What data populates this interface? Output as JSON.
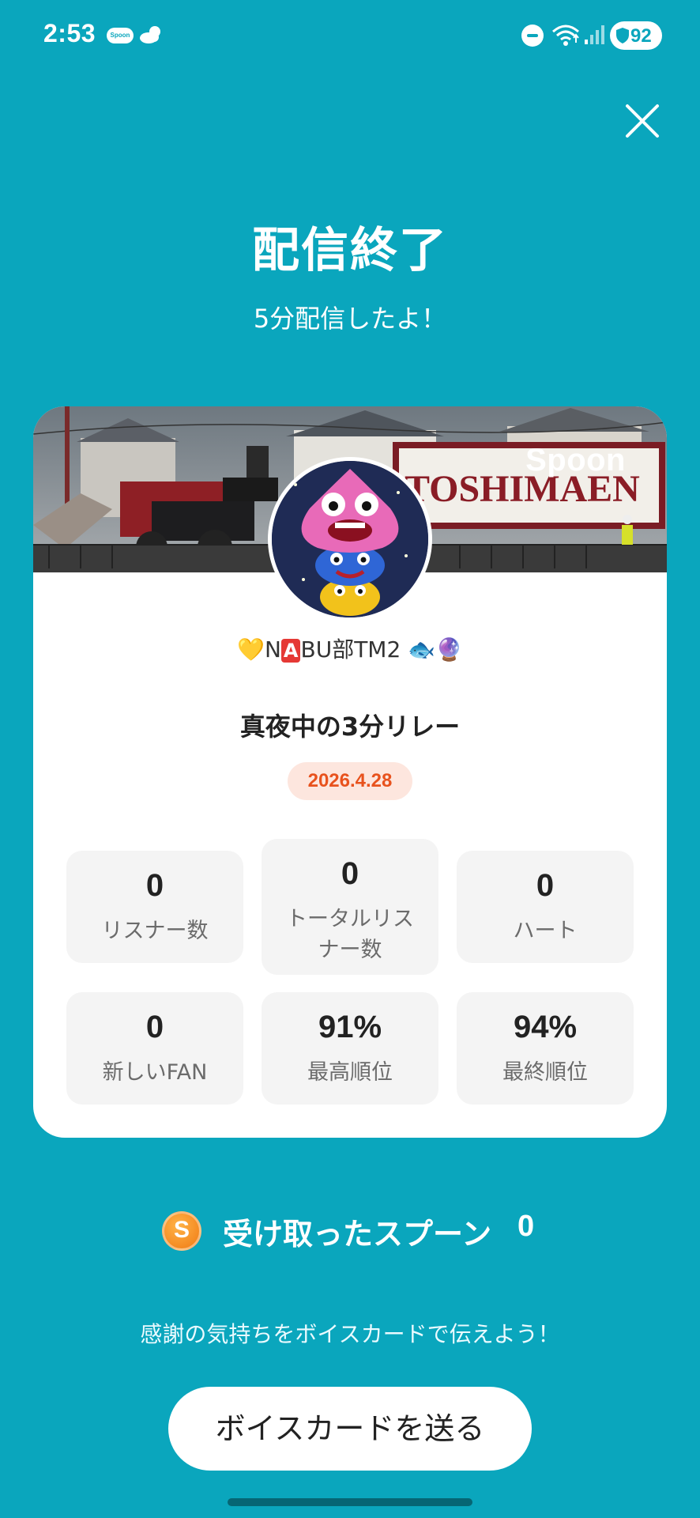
{
  "status_bar": {
    "time": "2:53",
    "app_badge": "Spoon",
    "battery": "92"
  },
  "header": {
    "title": "配信終了",
    "subtitle": "5分配信したよ！"
  },
  "card": {
    "banner_brand": "Spoon",
    "banner_sign": "TOSHIMAEN",
    "username_parts": {
      "heart": "💛",
      "n": "N",
      "a_badge": "A",
      "rest": "BU部TM2 ",
      "fish": "🐟",
      "ball": "🔮"
    },
    "show_title": "真夜中の3分リレー",
    "date": "2026.4.28",
    "stats": [
      {
        "value": "0",
        "label": "リスナー数"
      },
      {
        "value": "0",
        "label_line1": "トータルリス",
        "label_line2": "ナー数"
      },
      {
        "value": "0",
        "label": "ハート"
      },
      {
        "value": "0",
        "label": "新しいFAN"
      },
      {
        "value": "91%",
        "label": "最高順位"
      },
      {
        "value": "94%",
        "label": "最終順位"
      }
    ]
  },
  "spoons": {
    "coin_letter": "S",
    "label": "受け取ったスプーン",
    "count": "0"
  },
  "footer": {
    "message": "感謝の気持ちをボイスカードで伝えよう！",
    "button_label": "ボイスカードを送る"
  },
  "colors": {
    "background": "#0aa6bd",
    "date_badge_bg": "#fde6de",
    "date_badge_text": "#e8521d",
    "coin": "#f07a13"
  }
}
